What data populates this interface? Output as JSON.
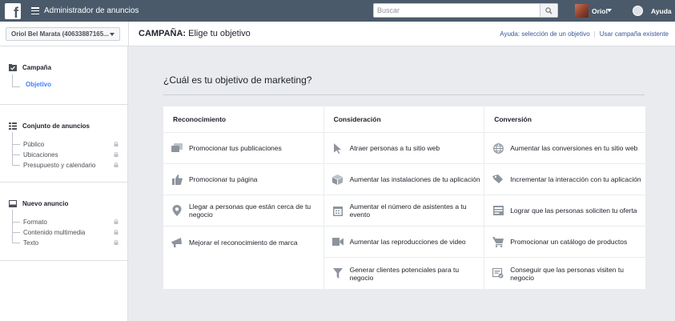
{
  "topbar": {
    "title": "Administrador de anuncios",
    "search_placeholder": "Buscar",
    "user_name": "Oriol",
    "help": "Ayuda"
  },
  "subheader": {
    "account": "Oriol Bel Marata (40633887165...",
    "breadcrumb_bold": "CAMPAÑA:",
    "breadcrumb_rest": " Elige tu objetivo",
    "help_link": "Ayuda: selección de un objetivo",
    "existing_link": "Usar campaña existente"
  },
  "sidebar": {
    "campaign": {
      "title": "Campaña",
      "items": [
        "Objetivo"
      ]
    },
    "adset": {
      "title": "Conjunto de anuncios",
      "items": [
        "Público",
        "Ubicaciones",
        "Presupuesto y calendario"
      ]
    },
    "ad": {
      "title": "Nuevo anuncio",
      "items": [
        "Formato",
        "Contenido multimedia",
        "Texto"
      ]
    }
  },
  "main": {
    "title": "¿Cuál es tu objetivo de marketing?",
    "columns": [
      {
        "header": "Reconocimiento",
        "options": [
          {
            "label": "Promocionar tus publicaciones",
            "icon": "posts-icon"
          },
          {
            "label": "Promocionar tu página",
            "icon": "like-icon"
          },
          {
            "label": "Llegar a personas que están cerca de tu negocio",
            "icon": "location-pin-icon"
          },
          {
            "label": "Mejorar el reconocimiento de marca",
            "icon": "megaphone-icon"
          }
        ]
      },
      {
        "header": "Consideración",
        "options": [
          {
            "label": "Atraer personas a tu sitio web",
            "icon": "cursor-icon"
          },
          {
            "label": "Aumentar las instalaciones de tu aplicación",
            "icon": "box-icon"
          },
          {
            "label": "Aumentar el número de asistentes a tu evento",
            "icon": "calendar-icon"
          },
          {
            "label": "Aumentar las reproducciones de video",
            "icon": "video-icon"
          },
          {
            "label": "Generar clientes potenciales para tu negocio",
            "icon": "funnel-icon"
          }
        ]
      },
      {
        "header": "Conversión",
        "options": [
          {
            "label": "Aumentar las conversiones en tu sitio web",
            "icon": "globe-icon"
          },
          {
            "label": "Incrementar la interacción con tu aplicación",
            "icon": "tag-icon"
          },
          {
            "label": "Lograr que las personas soliciten tu oferta",
            "icon": "offer-icon"
          },
          {
            "label": "Promocionar un catálogo de productos",
            "icon": "cart-icon"
          },
          {
            "label": "Conseguir que las personas visiten tu negocio",
            "icon": "store-icon"
          }
        ]
      }
    ]
  }
}
